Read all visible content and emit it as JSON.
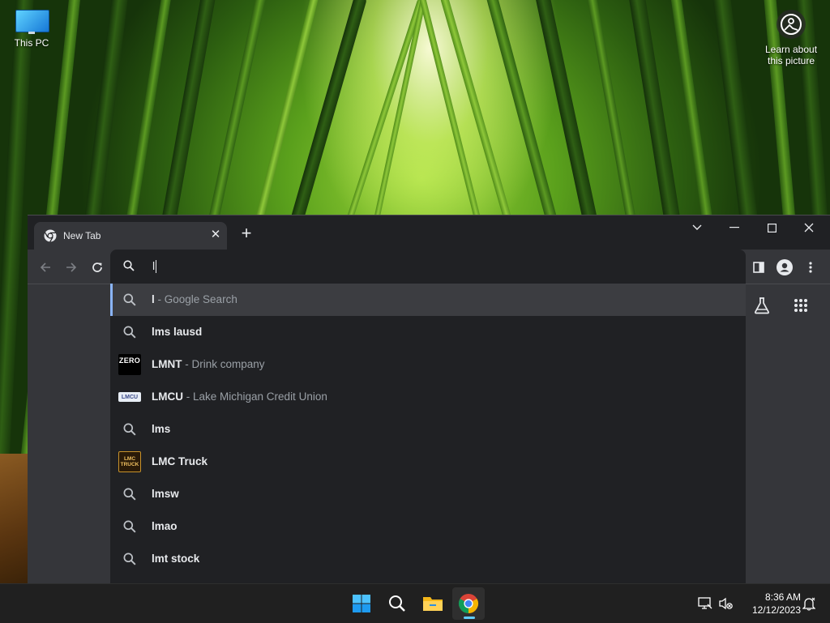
{
  "desktop": {
    "icons": [
      {
        "label": "This PC"
      }
    ],
    "spotlight": {
      "label_line1": "Learn about",
      "label_line2": "this picture"
    }
  },
  "browser": {
    "tab": {
      "title": "New Tab"
    },
    "omnibox": {
      "value": "l"
    },
    "suggestions": [
      {
        "icon": "search-icon",
        "main": "l",
        "separator": " - ",
        "desc": "Google Search",
        "selected": true
      },
      {
        "icon": "search-icon",
        "main": "lms lausd",
        "desc": ""
      },
      {
        "icon": "zero-logo",
        "main": "LMNT",
        "separator": " - ",
        "desc": "Drink company",
        "logo_text": "ZERO"
      },
      {
        "icon": "lmcu-logo",
        "main": "LMCU",
        "separator": " - ",
        "desc": "Lake Michigan Credit Union",
        "logo_text": "LMCU"
      },
      {
        "icon": "search-icon",
        "main": "lms",
        "desc": ""
      },
      {
        "icon": "lmc-truck-logo",
        "main": "LMC Truck",
        "desc": "",
        "logo_text": "LMC TRUCK"
      },
      {
        "icon": "search-icon",
        "main": "lmsw",
        "desc": ""
      },
      {
        "icon": "search-icon",
        "main": "lmao",
        "desc": ""
      },
      {
        "icon": "search-icon",
        "main": "lmt stock",
        "desc": ""
      }
    ]
  },
  "taskbar": {
    "time": "8:36 AM",
    "date": "12/12/2023"
  },
  "colors": {
    "accent": "#8ab4f8",
    "taskbar_active": "#60cdff"
  }
}
